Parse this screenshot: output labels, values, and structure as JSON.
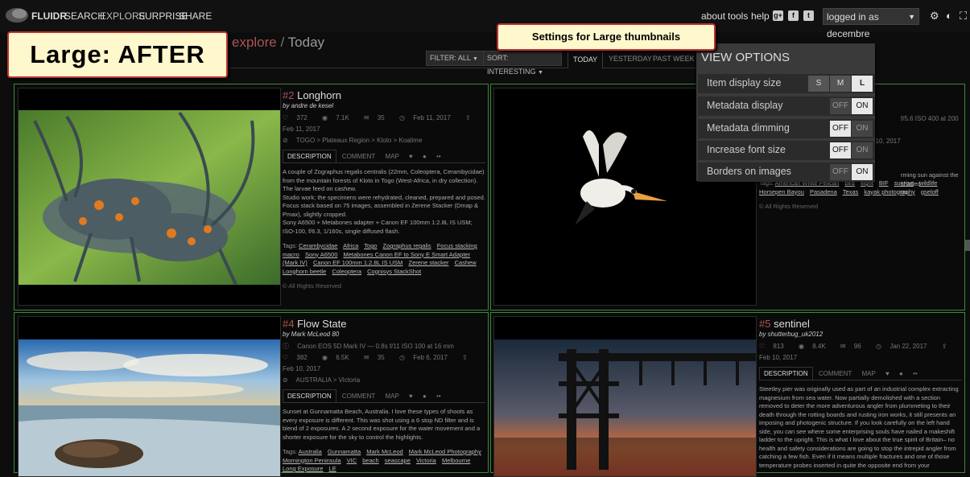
{
  "header": {
    "brand": "FLUIDR",
    "nav": [
      "SEARCH",
      "EXPLORE",
      "SURPRISE",
      "SHARE"
    ],
    "links": [
      "about",
      "tools",
      "help"
    ],
    "login_label": "logged in as decembre",
    "icons": [
      "gplus-icon",
      "facebook-icon",
      "twitter-icon",
      "gear-icon",
      "contrast-icon",
      "fullscreen-icon"
    ]
  },
  "callouts": {
    "large": "Large: AFTER",
    "settings": "Settings for Large thumbnails"
  },
  "page": {
    "section": "explore",
    "separator": "/",
    "period": "Today",
    "filter": "FILTER: ALL",
    "sort": "SORT: INTERESTING",
    "period_tabs": [
      "TODAY",
      "YESTERDAY",
      "PAST WEEK"
    ]
  },
  "view_options": {
    "title": "VIEW OPTIONS",
    "item_display_size": {
      "label": "Item display size",
      "options": [
        "S",
        "M",
        "L"
      ],
      "selected": "L"
    },
    "toggles": [
      {
        "label": "Metadata display",
        "off": "OFF",
        "on": "ON",
        "state": "on"
      },
      {
        "label": "Metadata dimming",
        "off": "OFF",
        "on": "ON",
        "state": "off"
      },
      {
        "label": "Increase font size",
        "off": "OFF",
        "on": "ON",
        "state": "off"
      },
      {
        "label": "Borders on images",
        "off": "OFF",
        "on": "ON",
        "state": "on"
      }
    ]
  },
  "photos": [
    {
      "rank": "#2",
      "title": "Longhorn",
      "author": "by andre de kesel",
      "faves": "372",
      "views": "7.1K",
      "comments": "35",
      "taken": "Feb 11, 2017",
      "uploaded": "Feb 11, 2017",
      "location": "TOGO > Plateaux Region > Kloto > Koalime",
      "tabs": [
        "DESCRIPTION",
        "COMMENT",
        "MAP"
      ],
      "description": [
        "A couple of Zographus regalis centralis (22mm, Coleoptera, Cerambycidae) from the mountain forests of Kloto in Togo (West-Africa, in dry collection). The larvae feed on cashew.",
        "Studio work; the specimens were rehydrated, cleaned, prepared and posed. Focus stack based on 75 images, assembled in Zerene Stacker (Dmap & Pmax), slightly cropped.",
        "Sony A6500 + Metabones adapter + Canon EF 100mm 1:2.8L IS USM; ISO-100, f/6.3, 1/160s, single diffused flash."
      ],
      "tags_label": "Tags:",
      "tags": [
        "Cerambycidae",
        "Africa",
        "Togo",
        "Zographus regalis",
        "Focus stacking",
        "macro",
        "Sony A6500",
        "Metabones Canon EF to Sony E Smart Adapter (Mark IV)",
        "Canon EF 100mm 1:2.8L IS USM",
        "Zerene stacker",
        "Cashew",
        "Longhorn beetle",
        "Coleoptera",
        "Cognisys StackShot"
      ],
      "rights": "All Rights Reserved"
    },
    {
      "rank": "",
      "title": "",
      "author": "",
      "exif": "f/5.6  ISO 400  at 200 mm",
      "uploaded": "Feb 10, 2017",
      "taken": "017",
      "description_fragment": "rming sun against the shaded",
      "description_fragment2": "ou.",
      "tags_label": "Tags:",
      "tags": [
        "American White Pelican",
        "bird",
        "flight",
        "BIF",
        "sunrise",
        "wildlife",
        "Horsepen Bayou",
        "Pasadena",
        "Texas",
        "kayak photography",
        "gseloff"
      ],
      "rights": "All Rights Reserved"
    },
    {
      "rank": "#4",
      "title": "Flow State",
      "author": "by Mark McLeod 80",
      "exif": "Canon EOS 5D Mark IV — 0.8s  f/11  ISO 100  at 16 mm",
      "faves": "382",
      "views": "6.5K",
      "comments": "35",
      "taken": "Feb 6, 2017",
      "uploaded": "Feb 10, 2017",
      "location": "AUSTRALIA > Victoria",
      "tabs": [
        "DESCRIPTION",
        "COMMENT",
        "MAP"
      ],
      "description": [
        "Sunset at Gunnamatta Beach, Australia. I love these types of shoots as every exposure is different. This was shot using a 6 stop ND filter and is blend of 2 exposures. A 2 second exposure for the water movement and a shorter exposure for the sky to control the highlights."
      ],
      "tags_label": "Tags:",
      "tags": [
        "Australia",
        "Gunnamatta",
        "Mark McLeod",
        "Mark McLeod Photography",
        "Mornington Peninsula",
        "VIC",
        "beach",
        "seascape",
        "Victoria",
        "Melbourne",
        "Long Exposure",
        "LE"
      ]
    },
    {
      "rank": "#5",
      "title": "sentinel",
      "author": "by shutterbug_uk2012",
      "faves": "813",
      "views": "8.4K",
      "comments": "96",
      "taken": "Jan 22, 2017",
      "uploaded": "Feb 10, 2017",
      "tabs": [
        "DESCRIPTION",
        "COMMENT",
        "MAP"
      ],
      "description": [
        "Steetley pier was originally used as part of an industrial complex extracting magnesium from sea water. Now partially demolished with a section removed to deter the more adventurous angler from plummeting to their death through the rotting boards and rusting iron works, it still presents an imposing and photogenic structure. If you look carefully on the left hand side, you can see where some enterprising souls have nailed a makeshift ladder to the upright. This is what I love about the true spirit of Britain– no health and safety considerations are going to stop the intrepid angler from catching a few fish. Even if it means multiple fractures and one of those temperature probes inserted in quite the opposite end from your"
      ]
    }
  ]
}
